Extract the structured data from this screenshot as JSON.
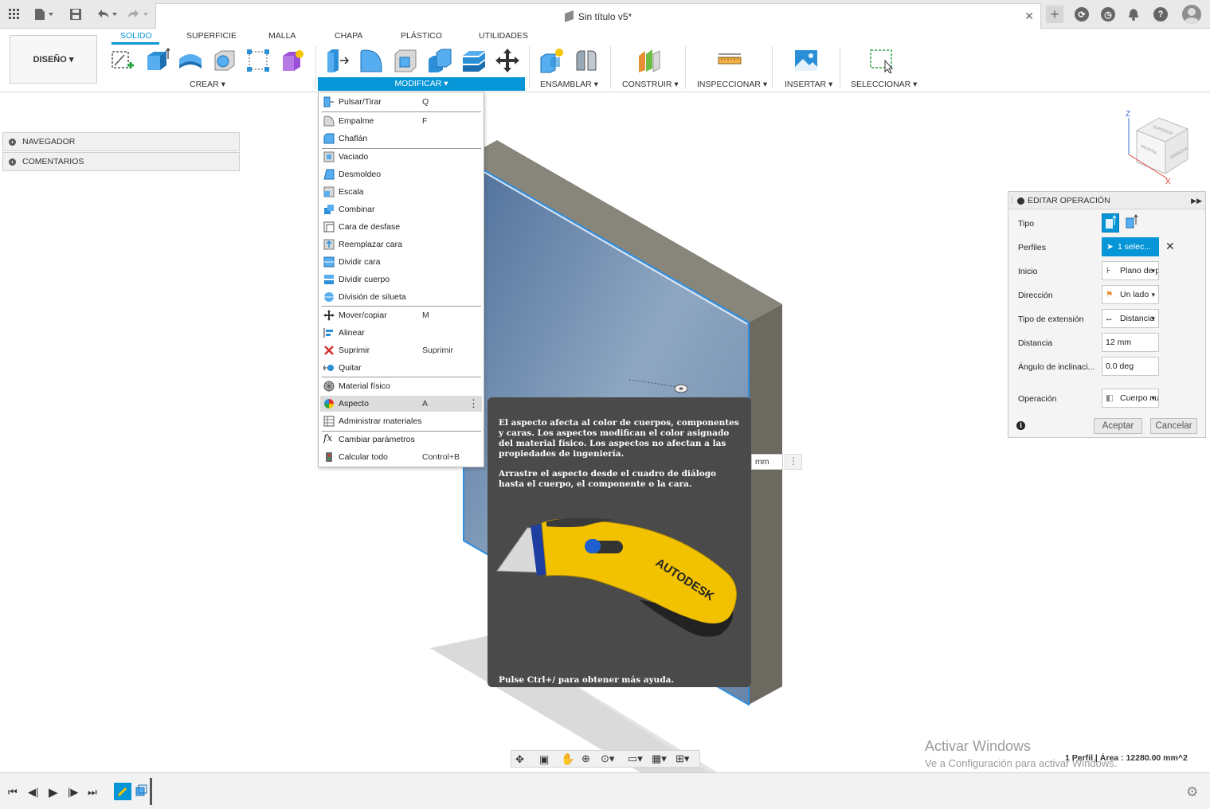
{
  "window": {
    "title": "Sin título v5*"
  },
  "ribbon": {
    "design_label": "DISEÑO ▾",
    "tabs": [
      "SOLIDO",
      "SUPERFICIE",
      "MALLA",
      "CHAPA",
      "PLÁSTICO",
      "UTILIDADES"
    ],
    "active_tab": "SOLIDO",
    "groups": [
      "CREAR ▾",
      "MODIFICAR ▾",
      "ENSAMBLAR ▾",
      "CONSTRUIR ▾",
      "INSPECCIONAR ▾",
      "INSERTAR ▾",
      "SELECCIONAR ▾"
    ]
  },
  "browser": {
    "items": [
      "NAVEGADOR",
      "COMENTARIOS"
    ]
  },
  "modify_menu": {
    "items": [
      {
        "label": "Pulsar/Tirar",
        "key": "Q",
        "icon": "press-pull-icon"
      },
      {
        "label": "Empalme",
        "key": "F",
        "icon": "fillet-icon"
      },
      {
        "label": "Chaflán",
        "key": "",
        "icon": "chamfer-icon"
      },
      {
        "label": "Vaciado",
        "key": "",
        "icon": "shell-icon"
      },
      {
        "label": "Desmoldeo",
        "key": "",
        "icon": "draft-icon"
      },
      {
        "label": "Escala",
        "key": "",
        "icon": "scale-icon"
      },
      {
        "label": "Combinar",
        "key": "",
        "icon": "combine-icon"
      },
      {
        "label": "Cara de desfase",
        "key": "",
        "icon": "offset-face-icon"
      },
      {
        "label": "Reemplazar cara",
        "key": "",
        "icon": "replace-face-icon"
      },
      {
        "label": "Dividir cara",
        "key": "",
        "icon": "split-face-icon"
      },
      {
        "label": "Dividir cuerpo",
        "key": "",
        "icon": "split-body-icon"
      },
      {
        "label": "División de silueta",
        "key": "",
        "icon": "silhouette-split-icon"
      },
      {
        "label": "Mover/copiar",
        "key": "M",
        "icon": "move-icon"
      },
      {
        "label": "Alinear",
        "key": "",
        "icon": "align-icon"
      },
      {
        "label": "Suprimir",
        "key": "Suprimir",
        "icon": "delete-icon"
      },
      {
        "label": "Quitar",
        "key": "",
        "icon": "remove-icon"
      },
      {
        "label": "Material físico",
        "key": "",
        "icon": "physical-material-icon"
      },
      {
        "label": "Aspecto",
        "key": "A",
        "icon": "appearance-icon"
      },
      {
        "label": "Administrar materiales",
        "key": "",
        "icon": "manage-materials-icon"
      },
      {
        "label": "Cambiar parámetros",
        "key": "",
        "icon": "fx-icon"
      },
      {
        "label": "Calcular todo",
        "key": "Control+B",
        "icon": "compute-all-icon"
      }
    ]
  },
  "tooltip": {
    "p1": "El aspecto afecta al color de cuerpos, componentes y caras. Los aspectos modifican el color asignado del material físico. Los aspectos no afectan a las propiedades de ingeniería.",
    "p2": "Arrastre el aspecto desde el cuadro de diálogo hasta el cuerpo, el componente o la cara.",
    "image_brand": "AUTODESK",
    "help": "Pulse Ctrl+/ para obtener más ayuda."
  },
  "dimension_input": {
    "unit": "mm"
  },
  "view_cube": {
    "faces": [
      "SUPERIOR",
      "FRONTAL",
      "DERECHA"
    ],
    "axes": [
      "Z",
      "X"
    ]
  },
  "edit_panel": {
    "title": "EDITAR OPERACIÓN",
    "rows": [
      {
        "label": "Tipo"
      },
      {
        "label": "Perfiles",
        "value": "1 selec..."
      },
      {
        "label": "Inicio",
        "value": "Plano de pe..."
      },
      {
        "label": "Dirección",
        "value": "Un lado"
      },
      {
        "label": "Tipo de extensión",
        "value": "Distancia"
      },
      {
        "label": "Distancia",
        "value": "12 mm"
      },
      {
        "label": "Ángulo de inclinaci...",
        "value": "0.0 deg"
      },
      {
        "label": "Operación",
        "value": "Cuerpo nu..."
      }
    ],
    "ok_label": "Aceptar",
    "cancel_label": "Cancelar"
  },
  "status": {
    "text": "1 Perfil | Área : 12280.00 mm^2"
  },
  "watermark": {
    "line1": "Activar Windows",
    "line2": "Ve a Configuración para activar Windows."
  }
}
